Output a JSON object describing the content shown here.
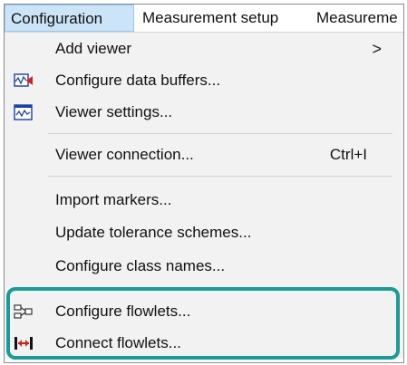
{
  "menubar": {
    "items": [
      {
        "label": "Configuration"
      },
      {
        "label": "Measurement setup"
      },
      {
        "label": "Measureme"
      }
    ]
  },
  "menu": {
    "add_viewer": {
      "label": "Add viewer",
      "submenu_glyph": ">"
    },
    "configure_data_buffers": {
      "label": "Configure data buffers...",
      "icon": "data-buffer-icon"
    },
    "viewer_settings": {
      "label": "Viewer settings...",
      "icon": "viewer-settings-icon"
    },
    "viewer_connection": {
      "label": "Viewer connection...",
      "shortcut": "Ctrl+I"
    },
    "import_markers": {
      "label": "Import markers..."
    },
    "update_tolerance": {
      "label": "Update tolerance schemes..."
    },
    "configure_class_names": {
      "label": "Configure class names..."
    },
    "configure_flowlets": {
      "label": "Configure flowlets...",
      "icon": "flowlets-config-icon"
    },
    "connect_flowlets": {
      "label": "Connect flowlets...",
      "icon": "connect-flowlets-icon"
    }
  },
  "colors": {
    "highlight": "#1a9c96",
    "menubar_active": "#cce4f7",
    "menu_background": "#f2f2f2"
  }
}
